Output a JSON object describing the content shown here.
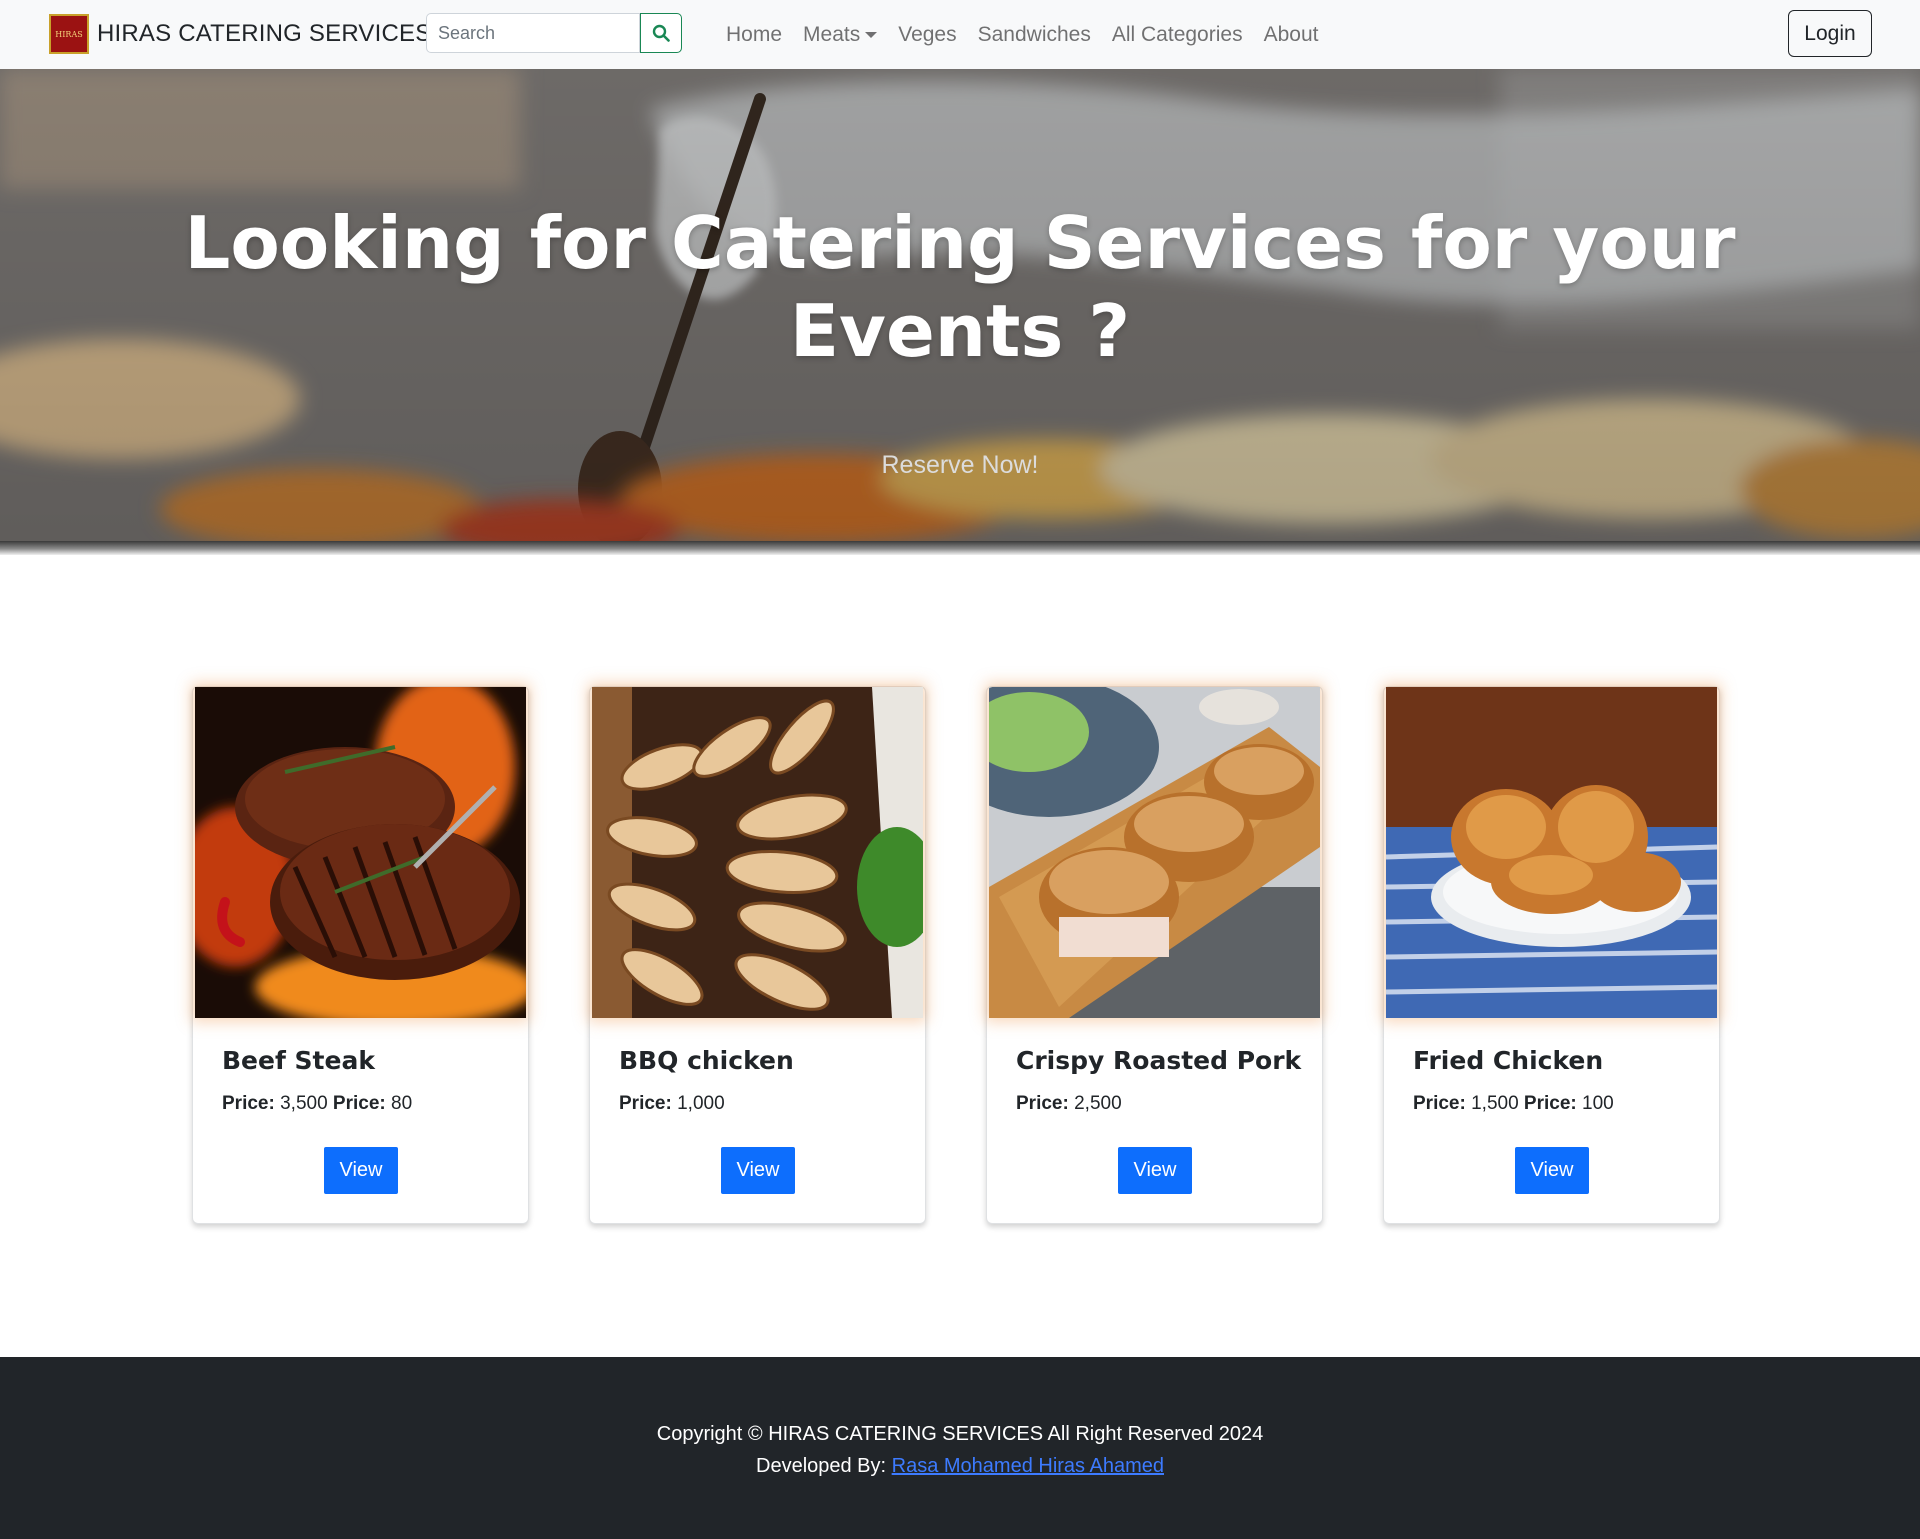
{
  "navbar": {
    "logo_text": "HIRAS",
    "brand": "HIRAS CATERING SERVICES",
    "search_placeholder": "Search",
    "links": [
      {
        "label": "Home"
      },
      {
        "label": "Meats"
      },
      {
        "label": "Veges"
      },
      {
        "label": "Sandwiches"
      },
      {
        "label": "All Categories"
      },
      {
        "label": "About"
      }
    ],
    "login": "Login"
  },
  "hero": {
    "title": "Looking for Catering Services for your Events ?",
    "subtitle": "Reserve Now!"
  },
  "products": [
    {
      "name": "Beef Steak",
      "price_label": "Price:",
      "price": "3,500",
      "price2_label": "Price:",
      "price2": "80",
      "button": "View"
    },
    {
      "name": "BBQ chicken",
      "price_label": "Price:",
      "price": "1,000",
      "price2_label": "",
      "price2": "",
      "button": "View"
    },
    {
      "name": "Crispy Roasted Pork",
      "price_label": "Price:",
      "price": "2,500",
      "price2_label": "",
      "price2": "",
      "button": "View"
    },
    {
      "name": "Fried Chicken",
      "price_label": "Price:",
      "price": "1,500",
      "price2_label": "Price:",
      "price2": "100",
      "button": "View"
    }
  ],
  "footer": {
    "copyright": "Copyright © HIRAS CATERING SERVICES All Right Reserved 2024",
    "developed_by": "Developed By:",
    "developer": "Rasa Mohamed Hiras Ahamed"
  },
  "colors": {
    "navbar_bg": "#f8f9fa",
    "primary": "#0d6efd",
    "search_green": "#198754",
    "footer_bg": "#212529",
    "link": "#3d7bff"
  },
  "icons": {
    "search_button": "search-icon",
    "meats_dropdown": "caret-down-icon"
  }
}
